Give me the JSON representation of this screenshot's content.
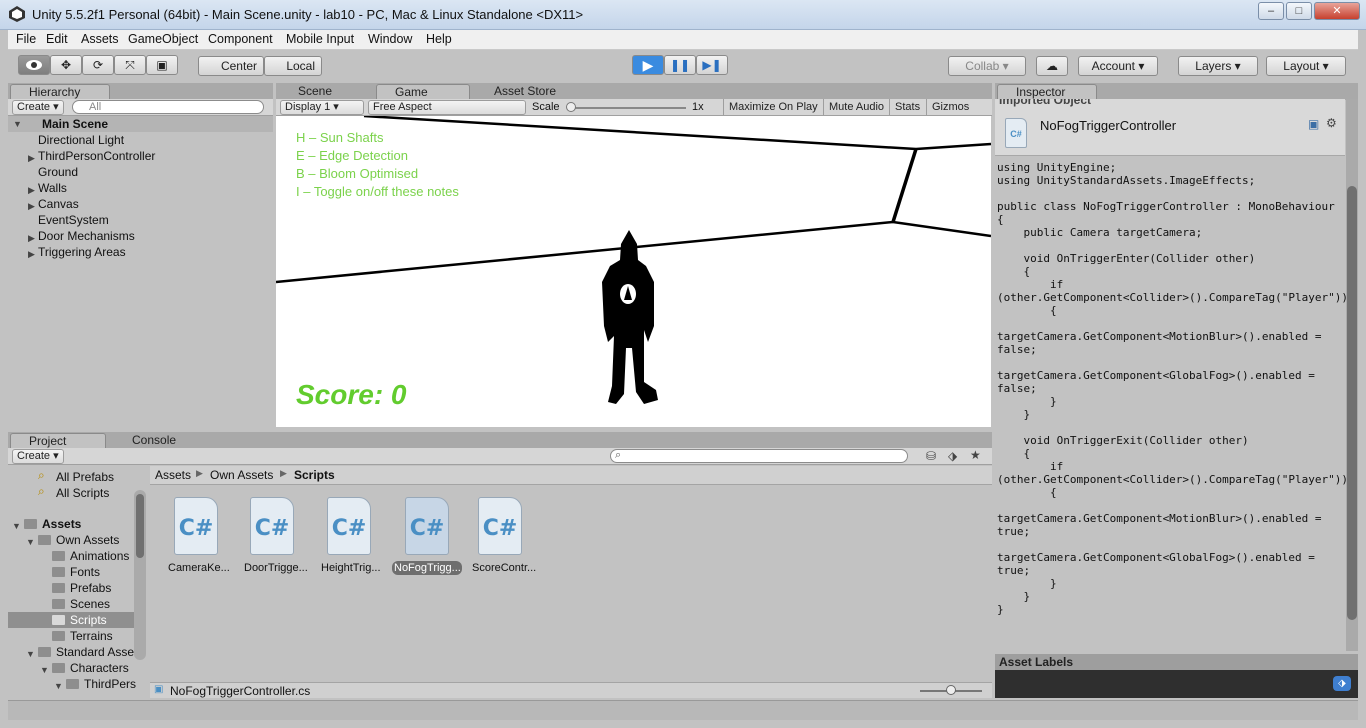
{
  "window": {
    "title": "Unity 5.5.2f1 Personal (64bit) - Main Scene.unity - lab10 - PC, Mac & Linux Standalone <DX11>",
    "min": "–",
    "max": "□",
    "close": "✕"
  },
  "menu": [
    "File",
    "Edit",
    "Assets",
    "GameObject",
    "Component",
    "Mobile Input",
    "Window",
    "Help"
  ],
  "toolbar": {
    "center": "Center",
    "local": "Local",
    "collab": "Collab ▾",
    "account": "Account",
    "layers": "Layers",
    "layout": "Layout"
  },
  "hierarchy": {
    "tab": "Hierarchy",
    "create": "Create",
    "search_placeholder": "All",
    "scene": "Main Scene",
    "items": [
      "Directional Light",
      "ThirdPersonController",
      "Ground",
      "Walls",
      "Canvas",
      "EventSystem",
      "Door Mechanisms",
      "Triggering Areas"
    ]
  },
  "center_tabs": {
    "scene": "Scene",
    "game": "Game",
    "asset_store": "Asset Store"
  },
  "game_bar": {
    "display": "Display 1",
    "aspect": "Free Aspect",
    "scale_label": "Scale",
    "scale_value": "1x",
    "maximize": "Maximize On Play",
    "mute": "Mute Audio",
    "stats": "Stats",
    "gizmos": "Gizmos"
  },
  "game": {
    "notes": [
      "H – Sun Shafts",
      "E – Edge Detection",
      "B – Bloom Optimised",
      "I – Toggle on/off these notes"
    ],
    "score": "Score: 0"
  },
  "project": {
    "tab_project": "Project",
    "tab_console": "Console",
    "create": "Create",
    "favorites": [
      "All Prefabs",
      "All Scripts"
    ],
    "tree": {
      "assets": "Assets",
      "own_assets": "Own Assets",
      "animations": "Animations",
      "fonts": "Fonts",
      "prefabs": "Prefabs",
      "scenes": "Scenes",
      "scripts": "Scripts",
      "terrains": "Terrains",
      "standard_assets": "Standard Asse",
      "characters": "Characters",
      "thirdperson": "ThirdPers"
    },
    "breadcrumb": [
      "Assets",
      "Own Assets",
      "Scripts"
    ],
    "assets": [
      "CameraKe...",
      "DoorTrigge...",
      "HeightTrig...",
      "NoFogTrigg...",
      "ScoreContr..."
    ],
    "selected_file": "NoFogTriggerController.cs"
  },
  "inspector": {
    "tab": "Inspector",
    "header_cut": "Imported Object",
    "name": "NoFogTriggerController",
    "icon_text": "C#",
    "asset_labels": "Asset Labels",
    "code": "using UnityEngine;\nusing UnityStandardAssets.ImageEffects;\n\npublic class NoFogTriggerController : MonoBehaviour\n{\n    public Camera targetCamera;\n\n    void OnTriggerEnter(Collider other)\n    {\n        if\n(other.GetComponent<Collider>().CompareTag(\"Player\"))\n        {\n\ntargetCamera.GetComponent<MotionBlur>().enabled =\nfalse;\n\ntargetCamera.GetComponent<GlobalFog>().enabled =\nfalse;\n        }\n    }\n\n    void OnTriggerExit(Collider other)\n    {\n        if\n(other.GetComponent<Collider>().CompareTag(\"Player\"))\n        {\n\ntargetCamera.GetComponent<MotionBlur>().enabled =\ntrue;\n\ntargetCamera.GetComponent<GlobalFog>().enabled =\ntrue;\n        }\n    }\n}"
  },
  "colors": {
    "note_green": "#7bd24b",
    "score_green": "#62cc2e",
    "play_blue": "#3a8be0"
  }
}
